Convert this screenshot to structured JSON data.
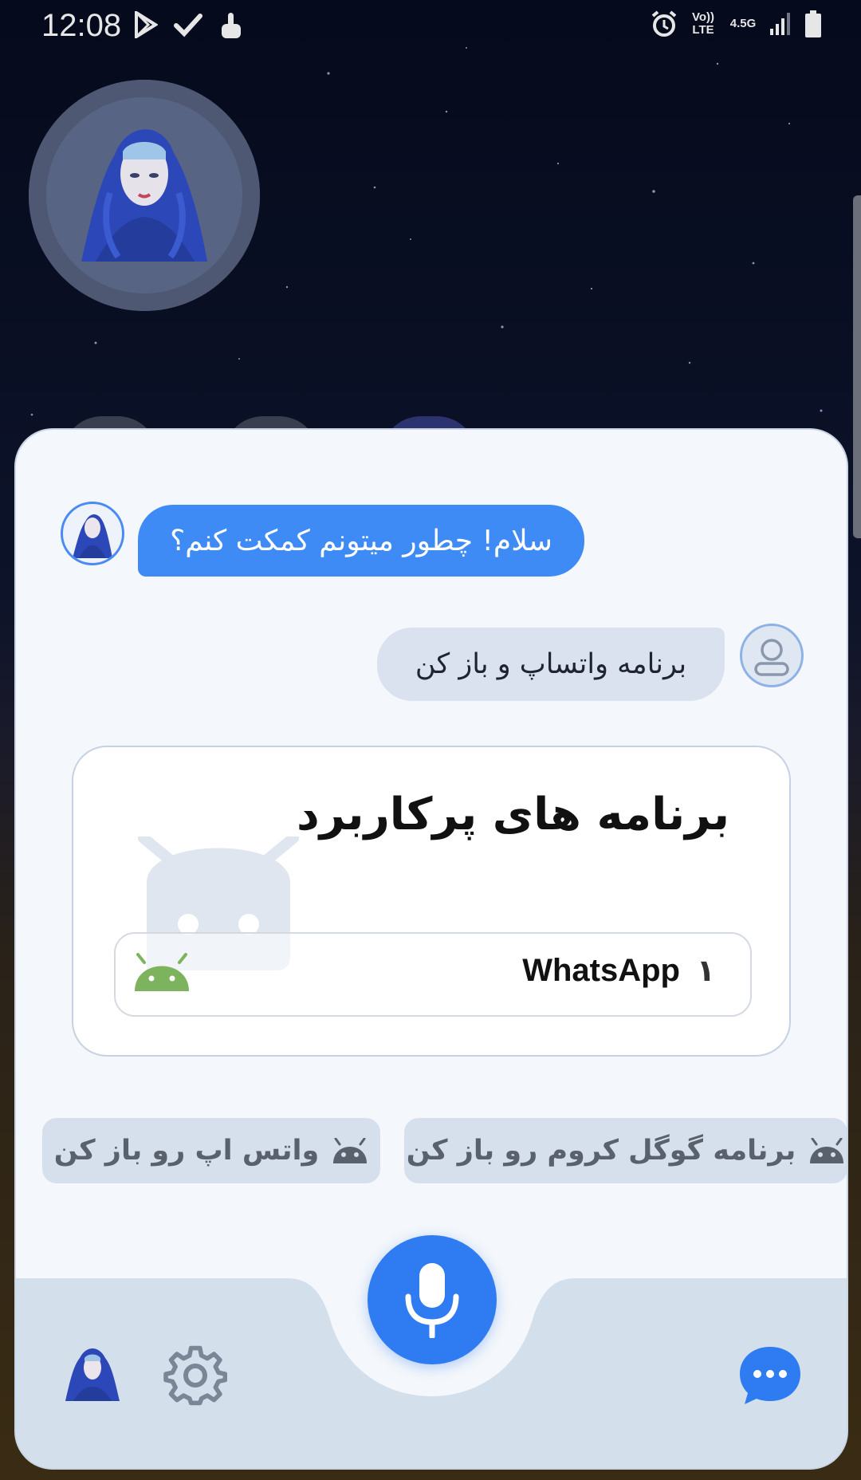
{
  "status_bar": {
    "time": "12:08",
    "left_icons": [
      "play-store-icon",
      "check-icon",
      "touch-icon"
    ],
    "volte": "Vo)) LTE",
    "network": "4.5G",
    "right_icons": [
      "alarm-icon",
      "signal-icon",
      "battery-icon"
    ]
  },
  "assistant": {
    "greeting": "سلام! چطور میتونم کمکت کنم؟",
    "user_message": "برنامه واتساپ و باز کن"
  },
  "apps_card": {
    "title": "برنامه های پرکاربرد",
    "items": [
      {
        "index": "۱",
        "name": "WhatsApp",
        "icon": "android-icon"
      }
    ]
  },
  "suggestions": [
    {
      "label": "برنامه گوگل کروم رو باز کن",
      "icon": "android-icon"
    },
    {
      "label": "واتس اپ رو باز کن",
      "icon": "android-icon"
    }
  ],
  "bottom_nav": {
    "icons": [
      "avatar",
      "gear-icon",
      "microphone-icon",
      "chat-bubble-icon"
    ]
  },
  "colors": {
    "accent": "#2f7cf2",
    "panel": "#f4f7fb",
    "bubble_user": "#d9e2ee",
    "bottom_bar": "#d4dfec",
    "android_green": "#7db35d"
  }
}
